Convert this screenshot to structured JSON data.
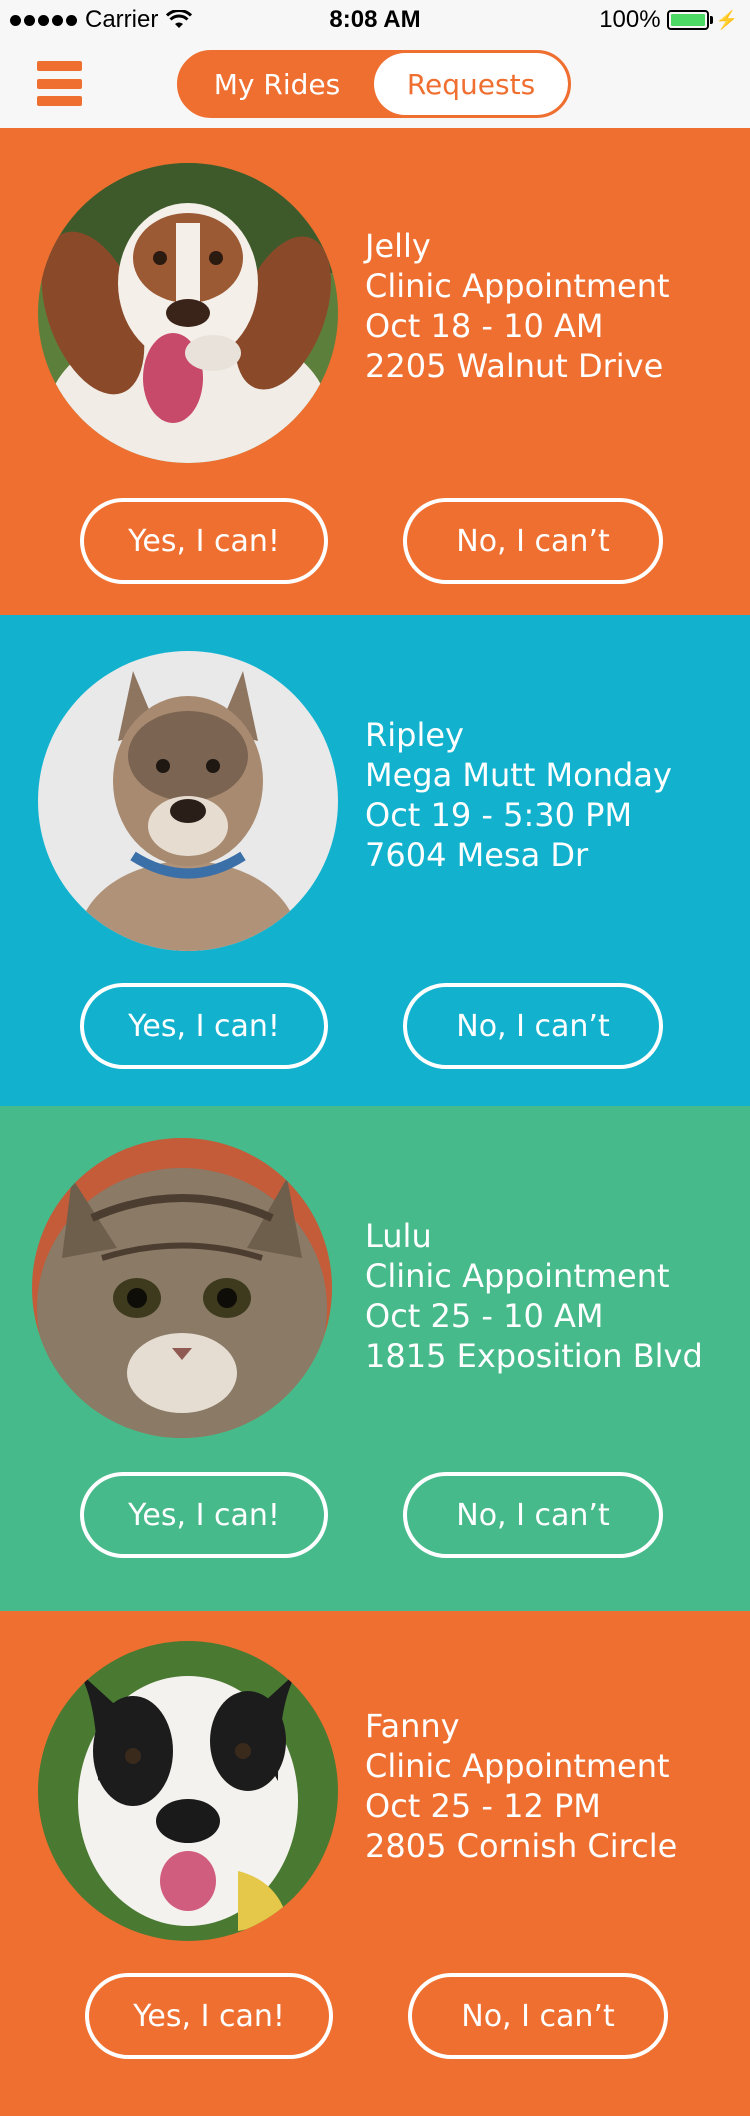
{
  "status_bar": {
    "carrier": "Carrier",
    "time": "8:08 AM",
    "battery": "100%"
  },
  "nav": {
    "tabs": [
      {
        "label": "My Rides",
        "active": false
      },
      {
        "label": "Requests",
        "active": true
      }
    ],
    "menu_icon": "hamburger-menu-icon"
  },
  "colors": {
    "orange": "#ef6f30",
    "blue": "#12b2ce",
    "green": "#46ba8a"
  },
  "requests": [
    {
      "pet": "Jelly",
      "event": "Clinic Appointment",
      "when": "Oct 18 - 10 AM",
      "address": "2205 Walnut Drive",
      "color": "#ef6f30",
      "yes_label": "Yes, I can!",
      "no_label": "No, I can’t"
    },
    {
      "pet": "Ripley",
      "event": "Mega Mutt Monday",
      "when": "Oct 19 - 5:30 PM",
      "address": "7604 Mesa Dr",
      "color": "#12b2ce",
      "yes_label": "Yes, I can!",
      "no_label": "No, I can’t"
    },
    {
      "pet": "Lulu",
      "event": "Clinic Appointment",
      "when": "Oct 25 - 10 AM",
      "address": "1815 Exposition Blvd",
      "color": "#46ba8a",
      "yes_label": "Yes, I can!",
      "no_label": "No, I can’t"
    },
    {
      "pet": "Fanny",
      "event": "Clinic Appointment",
      "when": "Oct 25 - 12 PM",
      "address": "2805 Cornish Circle",
      "color": "#ef6f30",
      "yes_label": "Yes, I can!",
      "no_label": "No, I can’t"
    }
  ]
}
